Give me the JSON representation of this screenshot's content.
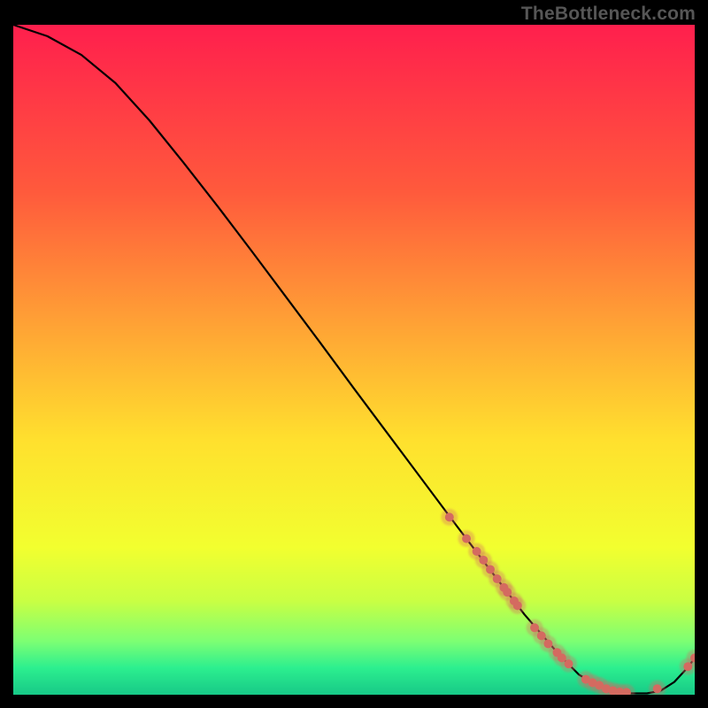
{
  "watermark": "TheBottleneck.com",
  "chart_data": {
    "type": "line",
    "title": "",
    "xlabel": "",
    "ylabel": "",
    "xlim": [
      0,
      100
    ],
    "ylim": [
      0,
      100
    ],
    "grid": false,
    "background_gradient": {
      "type": "vertical",
      "stops": [
        {
          "pos": 0.0,
          "color": "#ff1f4d"
        },
        {
          "pos": 0.25,
          "color": "#ff5a3c"
        },
        {
          "pos": 0.45,
          "color": "#ffa335"
        },
        {
          "pos": 0.62,
          "color": "#ffe02e"
        },
        {
          "pos": 0.78,
          "color": "#f2ff2f"
        },
        {
          "pos": 0.86,
          "color": "#c9ff43"
        },
        {
          "pos": 0.92,
          "color": "#7dff73"
        },
        {
          "pos": 0.96,
          "color": "#2cef8f"
        },
        {
          "pos": 1.0,
          "color": "#17c987"
        }
      ]
    },
    "curve": {
      "name": "bottleneck-curve",
      "color": "#000000",
      "x": [
        0,
        5,
        10,
        15,
        20,
        25,
        30,
        35,
        40,
        45,
        50,
        55,
        60,
        65,
        70,
        75,
        80,
        83,
        86,
        88,
        90,
        93,
        95,
        97,
        99,
        100
      ],
      "y": [
        100,
        98.3,
        95.5,
        91.3,
        85.7,
        79.4,
        72.9,
        66.2,
        59.4,
        52.6,
        45.7,
        38.9,
        32.1,
        25.3,
        18.6,
        12.0,
        6.1,
        3.0,
        1.2,
        0.5,
        0.2,
        0.2,
        0.6,
        1.9,
        4.1,
        5.5
      ]
    },
    "marker_segments": [
      {
        "name": "upper-band",
        "color": "#d46a60",
        "radius": 5,
        "glow": true,
        "points": [
          {
            "x": 64.0,
            "y": 26.5
          },
          {
            "x": 66.5,
            "y": 23.3
          },
          {
            "x": 68.0,
            "y": 21.4
          },
          {
            "x": 69.0,
            "y": 20.1
          },
          {
            "x": 70.0,
            "y": 18.7
          },
          {
            "x": 71.0,
            "y": 17.3
          },
          {
            "x": 72.0,
            "y": 16.0
          },
          {
            "x": 72.5,
            "y": 15.3
          },
          {
            "x": 73.5,
            "y": 14.0
          },
          {
            "x": 74.0,
            "y": 13.3
          }
        ]
      },
      {
        "name": "lower-fall",
        "color": "#d46a60",
        "radius": 5,
        "glow": true,
        "points": [
          {
            "x": 76.5,
            "y": 10.0
          },
          {
            "x": 77.5,
            "y": 8.8
          },
          {
            "x": 78.5,
            "y": 7.6
          },
          {
            "x": 79.8,
            "y": 6.3
          },
          {
            "x": 80.5,
            "y": 5.5
          },
          {
            "x": 81.5,
            "y": 4.6
          }
        ]
      },
      {
        "name": "finish-minimum",
        "color": "#d46a60",
        "radius": 5,
        "glow": true,
        "points": [
          {
            "x": 84.0,
            "y": 2.3
          },
          {
            "x": 85.0,
            "y": 1.8
          },
          {
            "x": 86.0,
            "y": 1.4
          },
          {
            "x": 87.0,
            "y": 0.9
          },
          {
            "x": 88.0,
            "y": 0.6
          },
          {
            "x": 89.0,
            "y": 0.4
          },
          {
            "x": 90.0,
            "y": 0.35
          }
        ]
      },
      {
        "name": "rising-tail",
        "color": "#d46a60",
        "radius": 5,
        "glow": true,
        "points": [
          {
            "x": 94.5,
            "y": 0.9
          },
          {
            "x": 99.0,
            "y": 4.2
          },
          {
            "x": 100.0,
            "y": 5.5
          }
        ]
      }
    ]
  }
}
